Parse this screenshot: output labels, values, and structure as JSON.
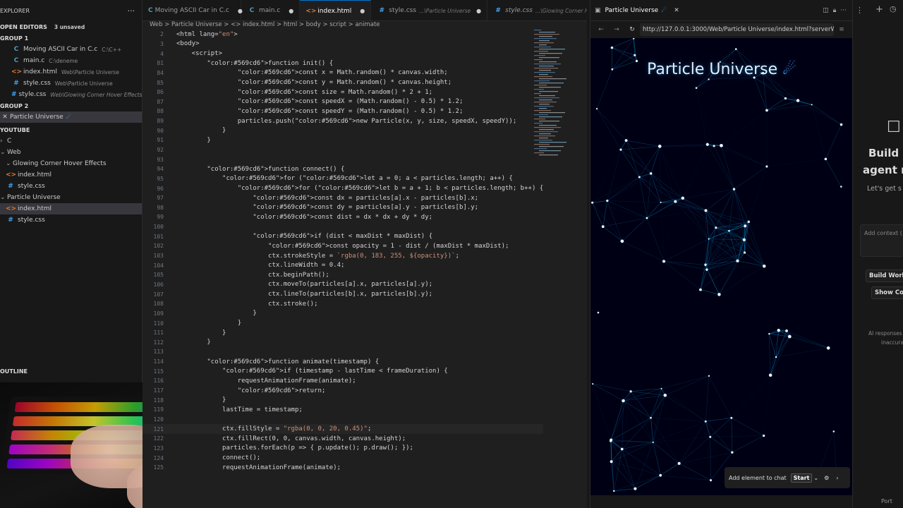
{
  "explorer": {
    "title": "EXPLORER",
    "open_editors_label": "OPEN EDITORS",
    "unsaved": "3 unsaved",
    "group1": "GROUP 1",
    "group2": "GROUP 2",
    "open_files": [
      {
        "icon": "C",
        "name": "Moving ASCII Car in C.c",
        "path": "C:\\C++"
      },
      {
        "icon": "C",
        "name": "main.c",
        "path": "C:\\deneme"
      },
      {
        "icon": "<>",
        "name": "index.html",
        "path": "Web\\Particle Universe"
      },
      {
        "icon": "#",
        "name": "style.css",
        "path": "Web\\Particle Universe"
      },
      {
        "icon": "#",
        "name": "style.css",
        "path": "Web\\Glowing Corner Hover Effects"
      }
    ],
    "group2_file": "Particle Universe",
    "workspace": "YOUTUBE",
    "tree": [
      {
        "name": "C",
        "kind": "folder"
      },
      {
        "name": "Web",
        "kind": "folder"
      },
      {
        "name": "Glowing Corner Hover Effects",
        "kind": "folder"
      },
      {
        "name": "index.html",
        "kind": "html"
      },
      {
        "name": "style.css",
        "kind": "css"
      },
      {
        "name": "Particle Universe",
        "kind": "folder"
      },
      {
        "name": "index.html",
        "kind": "html"
      },
      {
        "name": "style.css",
        "kind": "css"
      }
    ],
    "outline": "OUTLINE"
  },
  "tabs": [
    {
      "icon": "C",
      "label": "Moving ASCII Car in C.c",
      "path": ""
    },
    {
      "icon": "C",
      "label": "main.c",
      "path": ""
    },
    {
      "icon": "<>",
      "label": "index.html",
      "path": ""
    },
    {
      "icon": "#",
      "label": "style.css",
      "path": "...\\Particle Universe"
    },
    {
      "icon": "#",
      "label": "style.css",
      "path": "...\\Glowing Corner Hov"
    }
  ],
  "breadcrumb": "Web  >  Particle Universe  >  <> index.html  >  html  >  body  >  script  >  animate",
  "code_lines": [
    {
      "n": "2",
      "t": "<html lang=\"en\">"
    },
    {
      "n": "3",
      "t": "<body>"
    },
    {
      "n": "4",
      "t": "    <script>"
    },
    {
      "n": "81",
      "t": "        function init() {"
    },
    {
      "n": "84",
      "t": "                const x = Math.random() * canvas.width;"
    },
    {
      "n": "85",
      "t": "                const y = Math.random() * canvas.height;"
    },
    {
      "n": "86",
      "t": "                const size = Math.random() * 2 + 1;"
    },
    {
      "n": "87",
      "t": "                const speedX = (Math.random() - 0.5) * 1.2;"
    },
    {
      "n": "88",
      "t": "                const speedY = (Math.random() - 0.5) * 1.2;"
    },
    {
      "n": "89",
      "t": "                particles.push(new Particle(x, y, size, speedX, speedY));"
    },
    {
      "n": "90",
      "t": "            }"
    },
    {
      "n": "91",
      "t": "        }"
    },
    {
      "n": "92",
      "t": ""
    },
    {
      "n": "93",
      "t": ""
    },
    {
      "n": "94",
      "t": "        function connect() {"
    },
    {
      "n": "95",
      "t": "            for (let a = 0; a < particles.length; a++) {"
    },
    {
      "n": "96",
      "t": "                for (let b = a + 1; b < particles.length; b++) {"
    },
    {
      "n": "97",
      "t": "                    const dx = particles[a].x - particles[b].x;"
    },
    {
      "n": "98",
      "t": "                    const dy = particles[a].y - particles[b].y;"
    },
    {
      "n": "99",
      "t": "                    const dist = dx * dx + dy * dy;"
    },
    {
      "n": "100",
      "t": ""
    },
    {
      "n": "101",
      "t": "                    if (dist < maxDist * maxDist) {"
    },
    {
      "n": "102",
      "t": "                        const opacity = 1 - dist / (maxDist * maxDist);"
    },
    {
      "n": "103",
      "t": "                        ctx.strokeStyle = `rgba(0, 183, 255, ${opacity})`;"
    },
    {
      "n": "104",
      "t": "                        ctx.lineWidth = 0.4;"
    },
    {
      "n": "105",
      "t": "                        ctx.beginPath();"
    },
    {
      "n": "106",
      "t": "                        ctx.moveTo(particles[a].x, particles[a].y);"
    },
    {
      "n": "107",
      "t": "                        ctx.lineTo(particles[b].x, particles[b].y);"
    },
    {
      "n": "108",
      "t": "                        ctx.stroke();"
    },
    {
      "n": "109",
      "t": "                    }"
    },
    {
      "n": "110",
      "t": "                }"
    },
    {
      "n": "111",
      "t": "            }"
    },
    {
      "n": "112",
      "t": "        }"
    },
    {
      "n": "113",
      "t": ""
    },
    {
      "n": "114",
      "t": "        function animate(timestamp) {"
    },
    {
      "n": "115",
      "t": "            if (timestamp - lastTime < frameDuration) {"
    },
    {
      "n": "116",
      "t": "                requestAnimationFrame(animate);"
    },
    {
      "n": "117",
      "t": "                return;"
    },
    {
      "n": "118",
      "t": "            }"
    },
    {
      "n": "119",
      "t": "            lastTime = timestamp;"
    },
    {
      "n": "120",
      "t": ""
    },
    {
      "n": "121",
      "t": "            ctx.fillStyle = \"rgba(0, 0, 20, 0.45)\";"
    },
    {
      "n": "122",
      "t": "            ctx.fillRect(0, 0, canvas.width, canvas.height);"
    },
    {
      "n": "123",
      "t": "            particles.forEach(p => { p.update(); p.draw(); });"
    },
    {
      "n": "124",
      "t": "            connect();"
    },
    {
      "n": "125",
      "t": "            requestAnimationFrame(animate);"
    }
  ],
  "browser": {
    "tab_title": "Particle Universe",
    "url": "http://127.0.0.1:3000/Web/Particle Universe/index.html?serverWi",
    "page_title": "Particle Universe",
    "chat_label": "Add element to chat",
    "start_label": "Start"
  },
  "right_panel": {
    "heading1": "Build w",
    "heading2": "agent m",
    "sub": "Let's get s",
    "context": "Add context (",
    "btn1": "Build Work",
    "btn2": "Show Co",
    "note1": "AI responses",
    "note2": "inaccura",
    "port": "Port"
  },
  "colors": {
    "accent": "#0078d4",
    "particle": "#00b7ff",
    "bg": "#000014"
  }
}
